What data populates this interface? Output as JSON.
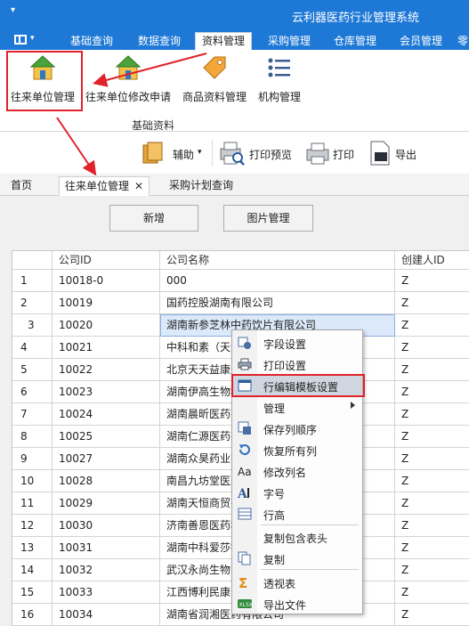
{
  "app": {
    "title": "云利器医药行业管理系统"
  },
  "menu_tabs": [
    "基础查询",
    "数据查询",
    "资料管理",
    "采购管理",
    "仓库管理",
    "会员管理",
    "零"
  ],
  "active_menu_tab": "资料管理",
  "ribbon": {
    "buttons": [
      {
        "label": "往来单位管理",
        "icon": "house-icon"
      },
      {
        "label": "往来单位修改申请",
        "icon": "house-icon"
      },
      {
        "label": "商品资料管理",
        "icon": "tag-icon"
      },
      {
        "label": "机构管理",
        "icon": "list-icon"
      }
    ],
    "group_label": "基础资料"
  },
  "toolbar": {
    "assist": "辅助",
    "print_preview": "打印预览",
    "print": "打印",
    "export": "导出"
  },
  "doc_tabs": [
    "首页",
    "往来单位管理",
    "采购计划查询"
  ],
  "active_doc_tab": "往来单位管理",
  "page_buttons": {
    "add": "新增",
    "image_manage": "图片管理"
  },
  "grid": {
    "columns": [
      "公司ID",
      "公司名称",
      "创建人ID"
    ],
    "rows": [
      {
        "n": "1",
        "id": "10018-0",
        "name": "000",
        "creator": "Z"
      },
      {
        "n": "2",
        "id": "10019",
        "name": "国药控股湖南有限公司",
        "creator": "Z"
      },
      {
        "n": "3",
        "id": "10020",
        "name": "湖南新参芝林中药饮片有限公司",
        "creator": "Z"
      },
      {
        "n": "4",
        "id": "10021",
        "name": "中科和素（天津",
        "creator": "Z"
      },
      {
        "n": "5",
        "id": "10022",
        "name": "北京天天益康生",
        "creator": "Z"
      },
      {
        "n": "6",
        "id": "10023",
        "name": "湖南伊高生物科",
        "creator": "Z"
      },
      {
        "n": "7",
        "id": "10024",
        "name": "湖南晨昕医药有",
        "creator": "Z"
      },
      {
        "n": "8",
        "id": "10025",
        "name": "湖南仁源医药有",
        "creator": "Z"
      },
      {
        "n": "9",
        "id": "10027",
        "name": "湖南众昊药业有",
        "creator": "Z"
      },
      {
        "n": "10",
        "id": "10028",
        "name": "南昌九坊堂医药",
        "creator": "Z"
      },
      {
        "n": "11",
        "id": "10029",
        "name": "湖南天恒商贸有",
        "creator": "Z"
      },
      {
        "n": "12",
        "id": "10030",
        "name": "济南善恩医药科",
        "creator": "Z"
      },
      {
        "n": "13",
        "id": "10031",
        "name": "湖南中科爱莎银",
        "creator": "Z"
      },
      {
        "n": "14",
        "id": "10032",
        "name": "武汉永尚生物医",
        "creator": "Z"
      },
      {
        "n": "15",
        "id": "10033",
        "name": "江西博利民康医",
        "creator": "Z"
      },
      {
        "n": "16",
        "id": "10034",
        "name": "湖南省润湘医药有限公司",
        "creator": "Z"
      }
    ],
    "selected_row_indicator": "▸"
  },
  "context_menu": {
    "items": [
      {
        "label": "字段设置",
        "icon": "field-settings-icon"
      },
      {
        "label": "打印设置",
        "icon": "printer-icon"
      },
      {
        "label": "行编辑模板设置",
        "icon": "window-icon"
      },
      {
        "label": "管理",
        "icon": "",
        "submenu": true
      },
      {
        "label": "保存列顺序",
        "icon": "save-order-icon"
      },
      {
        "label": "恢复所有列",
        "icon": "restore-icon"
      },
      {
        "label": "修改列名",
        "icon": "font-aa-icon"
      },
      {
        "label": "字号",
        "icon": "font-size-icon"
      },
      {
        "label": "行高",
        "icon": "row-height-icon"
      },
      {
        "label": "复制包含表头",
        "icon": ""
      },
      {
        "label": "复制",
        "icon": "copy-icon"
      },
      {
        "label": "透视表",
        "icon": "sigma-icon"
      },
      {
        "label": "导出文件",
        "icon": "xlsx-icon"
      }
    ],
    "highlighted": "行编辑模板设置"
  },
  "colors": {
    "brand_blue": "#1e78d6",
    "annotation_red": "#e0222a"
  }
}
